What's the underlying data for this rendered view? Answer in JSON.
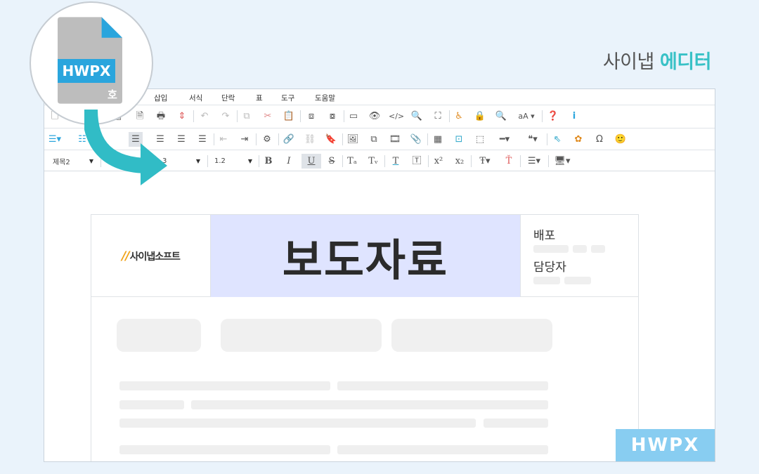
{
  "brand": {
    "name": "사이냅",
    "accent": "에디터"
  },
  "file_icon": {
    "label": "HWPX",
    "glyph": "호"
  },
  "menu": [
    "삽입",
    "서식",
    "단락",
    "표",
    "도구",
    "도움말"
  ],
  "toolbar": {
    "text_style_label": "aA",
    "style_select": "제목2",
    "font_size": "3",
    "line_height": "1.2"
  },
  "document": {
    "logo_text": "사이냅소프트",
    "title": "보도자료",
    "release_label": "배포",
    "contact_label": "담당자"
  },
  "badge": "HWPX",
  "colors": {
    "accent": "#38c1c6",
    "file_blue": "#2aa5dd",
    "arrow": "#31bcc6",
    "title_bg": "#dfe4ff",
    "badge_bg": "#88cdf1"
  }
}
